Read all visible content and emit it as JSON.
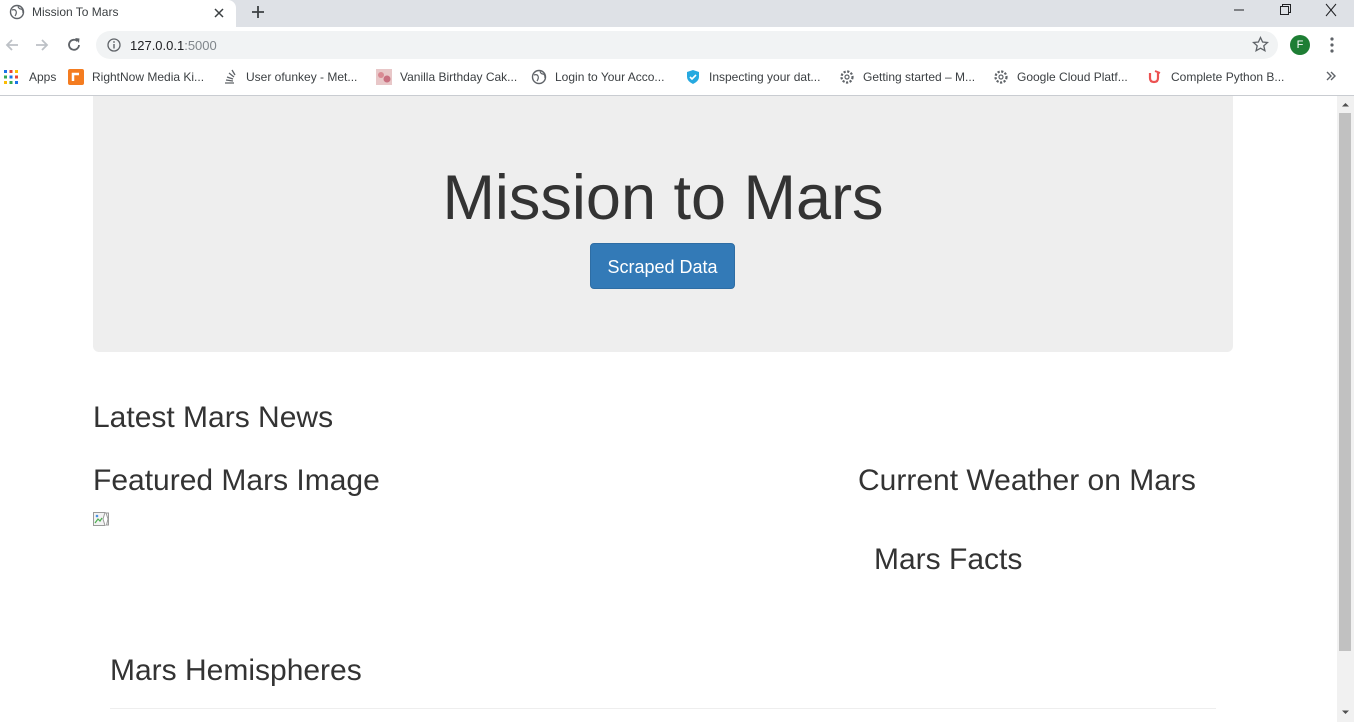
{
  "browser": {
    "tab_title": "Mission To Mars",
    "url_host": "127.0.0.1",
    "url_port": ":5000",
    "profile_initial": "F",
    "bookmarks": [
      {
        "label": "Apps",
        "icon": "apps-grid-icon"
      },
      {
        "label": "RightNow Media Ki...",
        "icon": "rightnow-media-icon"
      },
      {
        "label": "User ofunkey - Met...",
        "icon": "stackexchange-icon"
      },
      {
        "label": "Vanilla Birthday Cak...",
        "icon": "cake-thumbnail-icon"
      },
      {
        "label": "Login to Your Acco...",
        "icon": "globe-icon"
      },
      {
        "label": "Inspecting your dat...",
        "icon": "shield-icon"
      },
      {
        "label": "Getting started – M...",
        "icon": "gear-icon"
      },
      {
        "label": "Google Cloud Platf...",
        "icon": "gear-icon"
      },
      {
        "label": "Complete Python B...",
        "icon": "udemy-icon"
      }
    ]
  },
  "page": {
    "title": "Mission to Mars",
    "scrape_button": "Scraped Data",
    "news_heading": "Latest Mars News",
    "featured_heading": "Featured Mars Image",
    "weather_heading": "Current Weather on Mars",
    "facts_heading": "Mars Facts",
    "hemispheres_heading": "Mars Hemispheres"
  },
  "colors": {
    "primary_button": "#337ab7",
    "jumbotron_bg": "#eeeeee",
    "profile_avatar": "#1e7e34"
  }
}
